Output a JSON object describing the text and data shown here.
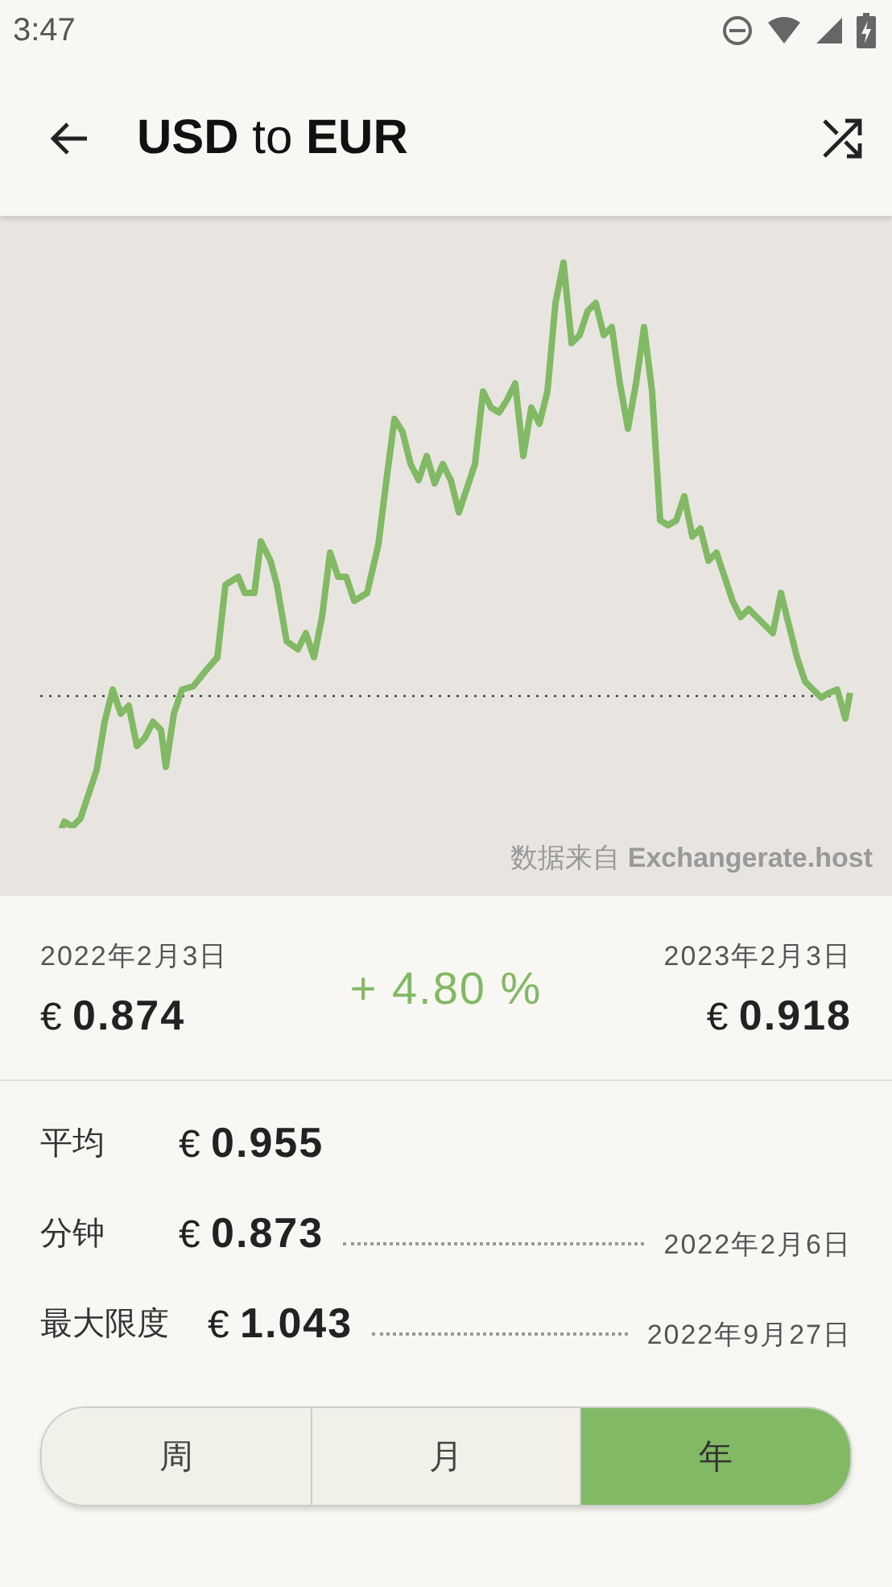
{
  "status_bar": {
    "time": "3:47"
  },
  "app_bar": {
    "title": "**USD** to **EUR**"
  },
  "chart": {
    "source": "数据来自 **Exchangerate.host**"
  },
  "summary": {
    "start": {
      "date": "2022年2月3日",
      "value": "€ **0.874**"
    },
    "change": "+ 4.80 %",
    "end": {
      "date": "2023年2月3日",
      "value": "€ **0.918**"
    }
  },
  "stats": [
    {
      "label": "平均",
      "value": "€ **0.955**"
    },
    {
      "label": "分钟",
      "value": "€ **0.873**",
      "date": "2022年2月6日"
    },
    {
      "label": "最大限度",
      "value": "€ **1.043**",
      "date": "2022年9月27日"
    }
  ],
  "tabs": [
    {
      "label": "周",
      "selected": false
    },
    {
      "label": "月",
      "selected": false
    },
    {
      "label": "年",
      "selected": true
    }
  ]
}
